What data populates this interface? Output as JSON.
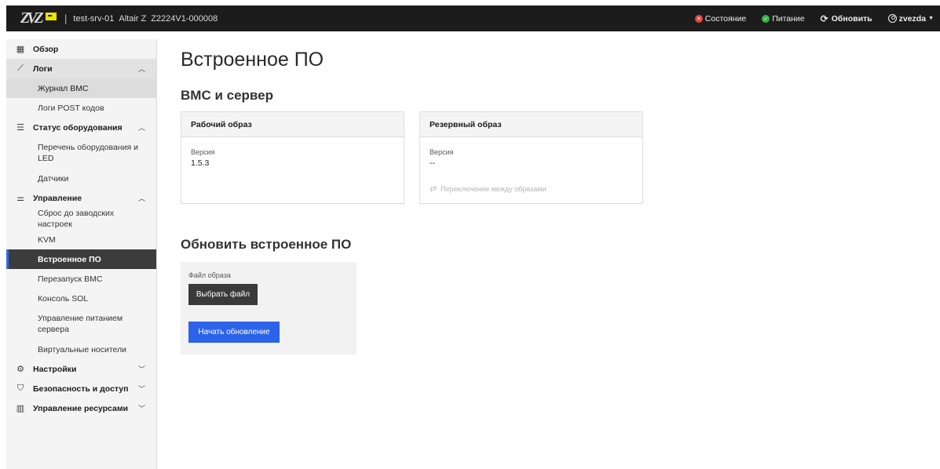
{
  "header": {
    "separator": "|",
    "host": "test-srv-01",
    "model": "Altair Z",
    "serial": "Z2224V1-000008",
    "status_label": "Состояние",
    "status_color": "#e0443b",
    "power_label": "Питание",
    "power_color": "#31b24a",
    "refresh_label": "Обновить",
    "user_label": "zvezda"
  },
  "sidebar": {
    "overview": "Обзор",
    "logs": {
      "label": "Логи",
      "items": [
        "Журнал BMC",
        "Логи POST кодов"
      ]
    },
    "hardware": {
      "label": "Статус оборудования",
      "items": [
        "Перечень оборудования и LED",
        "Датчики"
      ]
    },
    "control": {
      "label": "Управление",
      "items": [
        "Сброс до заводских настроек",
        "KVM",
        "Встроенное ПО",
        "Перезапуск BMC",
        "Консоль SOL",
        "Управление питанием сервера",
        "Виртуальные носители"
      ]
    },
    "settings": "Настройки",
    "security": "Безопасность и доступ",
    "resources": "Управление ресурсами"
  },
  "main": {
    "title": "Встроенное ПО",
    "section_bmc": "BMC и сервер",
    "primary": {
      "header": "Рабочий образ",
      "version_label": "Версия",
      "version": "1.5.3"
    },
    "backup": {
      "header": "Резервный образ",
      "version_label": "Версия",
      "version": "--",
      "switch_label": "Переключение между образами"
    },
    "section_update": "Обновить встроенное ПО",
    "update": {
      "file_label": "Файл образа",
      "choose_button": "Выбрать файл",
      "start_button": "Начать обновление"
    }
  },
  "colors": {
    "accent": "#2c63e8",
    "active_nav": "#3c3c3c"
  }
}
